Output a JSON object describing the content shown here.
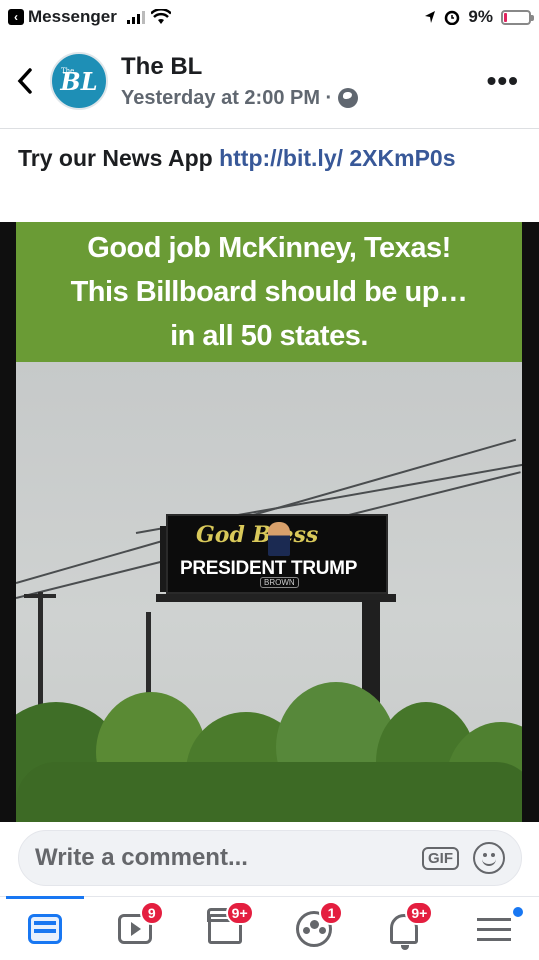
{
  "status_bar": {
    "app_back": "Messenger",
    "battery": "9%",
    "battery_level": 0.09
  },
  "post": {
    "page_name": "The BL",
    "avatar_text": "BL",
    "avatar_small": "The",
    "timestamp": "Yesterday at 2:00 PM ·",
    "text": "Try our News App ",
    "link": "http://bit.ly/ 2XKmP0s"
  },
  "image": {
    "banner_lines": [
      "Good job McKinney, Texas!",
      "This Billboard should be up…",
      "in all 50 states."
    ],
    "billboard_script": "God Bless",
    "billboard_main": "PRESIDENT TRUMP",
    "billboard_brand": "BROWN"
  },
  "comment": {
    "placeholder": "Write a comment...",
    "gif": "GIF"
  },
  "nav": {
    "badges": {
      "video": "9",
      "marketplace": "9+",
      "groups": "1",
      "notifications": "9+"
    }
  },
  "colors": {
    "facebook_blue": "#1877f2",
    "link": "#385898",
    "banner_green": "#6a9b35",
    "badge_red": "#e41e3f"
  }
}
